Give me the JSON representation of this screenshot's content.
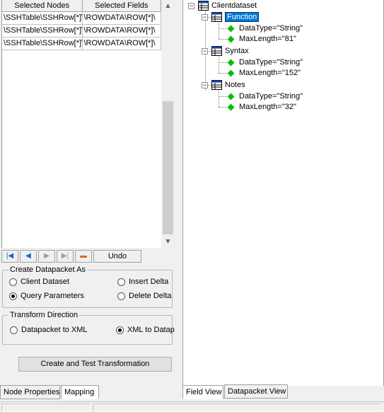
{
  "grid": {
    "columns": [
      "Selected Nodes",
      "Selected Fields"
    ],
    "rows": [
      [
        "\\SSHTable\\SSHRow[*]\\",
        "\\ROWDATA\\ROW[*]\\"
      ],
      [
        "\\SSHTable\\SSHRow[*]\\",
        "\\ROWDATA\\ROW[*]\\"
      ],
      [
        "\\SSHTable\\SSHRow[*]\\",
        "\\ROWDATA\\ROW[*]\\"
      ]
    ]
  },
  "navigator": {
    "undo_label": "Undo"
  },
  "create_datapacket": {
    "title": "Create Datapacket As",
    "options": [
      {
        "label": "Client Dataset",
        "checked": false
      },
      {
        "label": "Query Parameters",
        "checked": true
      },
      {
        "label": "Insert Delta",
        "checked": false
      },
      {
        "label": "Delete Delta",
        "checked": false
      }
    ]
  },
  "transform_direction": {
    "title": "Transform Direction",
    "options": [
      {
        "label": "Datapacket to XML",
        "checked": false
      },
      {
        "label": "XML to Datap",
        "checked": true
      }
    ]
  },
  "create_button_label": "Create and Test Transformation",
  "left_tabs": [
    "Node Properties",
    "Mapping"
  ],
  "left_active_tab": "Mapping",
  "tree": {
    "root": "Clientdataset",
    "nodes": [
      {
        "label": "Function",
        "selected": true,
        "attrs": [
          "DataType=\"String\"",
          "MaxLength=\"81\""
        ]
      },
      {
        "label": "Syntax",
        "selected": false,
        "attrs": [
          "DataType=\"String\"",
          "MaxLength=\"152\""
        ]
      },
      {
        "label": "Notes",
        "selected": false,
        "attrs": [
          "DataType=\"String\"",
          "MaxLength=\"32\""
        ]
      }
    ]
  },
  "right_tabs": [
    "Field View",
    "Datapacket View"
  ],
  "right_active_tab": "Field View",
  "colors": {
    "selection": "#0078d7",
    "leaf": "#00c000",
    "nav_arrow": "#1a5fd0"
  },
  "icons": {
    "root": "dataset-icon",
    "field": "field-table-icon",
    "leaf": "attribute-diamond-icon"
  }
}
